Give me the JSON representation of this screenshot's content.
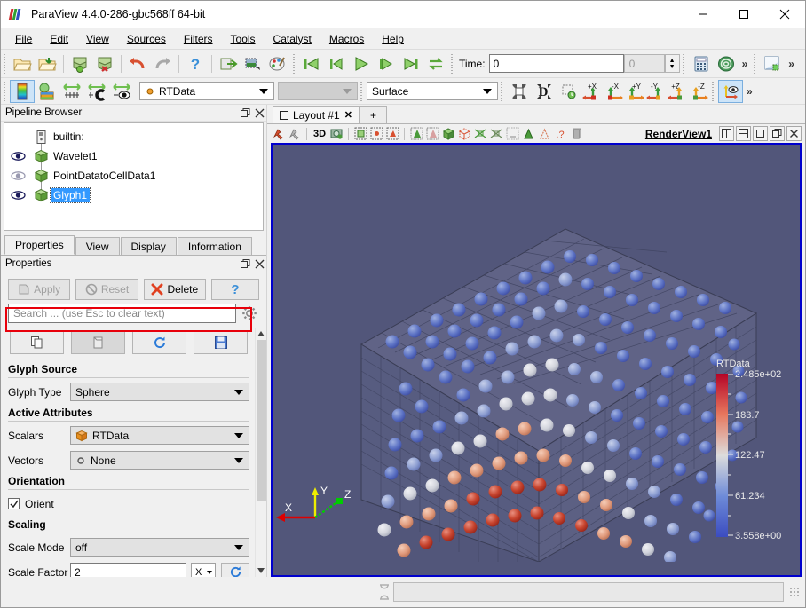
{
  "window": {
    "title": "ParaView 4.4.0-286-gbc568ff 64-bit",
    "minimize": "—",
    "maximize": "□",
    "close": "✕"
  },
  "menu": [
    {
      "label": "File",
      "mnemonic": "F"
    },
    {
      "label": "Edit",
      "mnemonic": "E"
    },
    {
      "label": "View",
      "mnemonic": "V"
    },
    {
      "label": "Sources",
      "mnemonic": "S"
    },
    {
      "label": "Filters",
      "mnemonic": "F"
    },
    {
      "label": "Tools",
      "mnemonic": "T"
    },
    {
      "label": "Catalyst",
      "mnemonic": "C"
    },
    {
      "label": "Macros",
      "mnemonic": "M"
    },
    {
      "label": "Help",
      "mnemonic": "H"
    }
  ],
  "main_toolbar": {
    "icons": [
      "open-file-icon",
      "open-recent-icon",
      "save-data-icon",
      "save-state-icon",
      "undo-icon",
      "redo-icon",
      "help-icon",
      "connect-server-icon",
      "disconnect-server-icon",
      "color-palette-icon"
    ],
    "vcr": [
      "first-frame-icon",
      "previous-frame-icon",
      "play-icon",
      "next-frame-icon",
      "last-frame-icon",
      "loop-icon"
    ],
    "time_label": "Time:",
    "time_value": "0",
    "frame_value": "0",
    "overflow": "»",
    "extra_icons": [
      "calculator-icon",
      "contour-icon",
      "screenshot-icon"
    ]
  },
  "repr_toolbar": {
    "icons": [
      "color-map-editor-icon",
      "edit-color-legend-icon",
      "rescale-data-range-icon",
      "rescale-custom-range-icon",
      "rescale-visible-range-icon"
    ],
    "array_value": "RTData",
    "component_value": "",
    "representation_value": "Surface",
    "camera_icons": [
      "reset-camera-icon",
      "zoom-to-data-icon",
      "zoom-to-box-icon",
      "plus-x-icon",
      "minus-x-icon",
      "plus-y-icon",
      "minus-y-icon",
      "plus-z-icon",
      "minus-z-icon"
    ],
    "axes_toggle": "center-axes-visibility-icon",
    "overflow": "»"
  },
  "pipeline_browser": {
    "title": "Pipeline Browser",
    "undock": "❐",
    "close": "✕",
    "items": [
      {
        "label": "builtin:",
        "icon": "server-icon",
        "eye": false,
        "selected": false,
        "indent": 0
      },
      {
        "label": "Wavelet1",
        "icon": "source-box-icon",
        "eye": true,
        "eye_state": "visible",
        "selected": false,
        "indent": 1
      },
      {
        "label": "PointDatatoCellData1",
        "icon": "filter-box-icon",
        "eye": true,
        "eye_state": "hidden",
        "selected": false,
        "indent": 1
      },
      {
        "label": "Glyph1",
        "icon": "filter-box-icon",
        "eye": true,
        "eye_state": "visible",
        "selected": true,
        "indent": 1
      }
    ]
  },
  "panel_tabs": [
    {
      "label": "Properties",
      "active": true
    },
    {
      "label": "View",
      "active": false
    },
    {
      "label": "Display",
      "active": false
    },
    {
      "label": "Information",
      "active": false
    }
  ],
  "properties": {
    "title": "Properties",
    "undock": "❐",
    "close": "✕",
    "apply_label": "Apply",
    "apply_mnemonic": "A",
    "reset_label": "Reset",
    "reset_mnemonic": "R",
    "delete_label": "Delete",
    "delete_mnemonic": "D",
    "help_label": "?",
    "search_placeholder": "Search ... (use Esc to clear text)",
    "gear_icon": "gear-icon",
    "toolbar_icons": [
      "copy-properties-icon",
      "paste-properties-icon",
      "restore-defaults-icon",
      "save-as-defaults-icon"
    ],
    "sections": {
      "glyph_source": {
        "title": "Glyph Source",
        "glyph_type_label": "Glyph Type",
        "glyph_type_value": "Sphere"
      },
      "active_attributes": {
        "title": "Active Attributes",
        "scalars_label": "Scalars",
        "scalars_value": "RTData",
        "scalars_icon": "point-data-array-icon",
        "vectors_label": "Vectors",
        "vectors_value": "None",
        "vectors_icon": "none-array-icon",
        "highlight_color": "#e8000b"
      },
      "orientation": {
        "title": "Orientation",
        "orient_label": "Orient",
        "orient_checked": true
      },
      "scaling": {
        "title": "Scaling",
        "scale_mode_label": "Scale Mode",
        "scale_mode_value": "off",
        "scale_factor_label": "Scale Factor",
        "scale_factor_value": "2",
        "scale_factor_unit": "X",
        "recompute_icon": "recompute-icon"
      }
    }
  },
  "layout": {
    "tab_label": "Layout #1",
    "tab_close": "✕",
    "new_tab": "+",
    "view_toolbar_icons": [
      "interactive-select-icon",
      "interactive-points-icon",
      "3D",
      "camera-icon",
      "select-cells-icon",
      "select-points-icon",
      "select-cells-through-icon",
      "select-points-polygon-icon",
      "select-cells-polygon-icon",
      "select-block-icon",
      "hover-cells-icon",
      "hover-points-icon",
      "clear-selection-icon",
      "find-data-icon",
      "plot-over-time-icon",
      "question-icon",
      "trash-icon"
    ],
    "view_3d_label": "3D",
    "view_name": "RenderView1",
    "window_buttons": [
      "split-horizontal-icon",
      "split-vertical-icon",
      "maximize-view-icon",
      "undock-view-icon",
      "close-view-icon"
    ]
  },
  "render_view": {
    "background_color": "#52567a",
    "border_color": "#0000cd",
    "scalar_bar": {
      "title": "RTData",
      "ticks": [
        "2.485e+02",
        "183.7",
        "122.47",
        "61.234",
        "3.558e+00"
      ],
      "min": 3.558,
      "max": 248.5,
      "colormap": "Cool to Warm",
      "color_low": "#3b4cc0",
      "color_mid": "#dddddd",
      "color_high": "#b40426"
    },
    "orientation_axes": {
      "x_label": "X",
      "x_color": "#dd0000",
      "y_label": "Y",
      "y_color": "#eeee00",
      "z_label": "Z",
      "z_color": "#00cc00"
    },
    "dataset": "Wavelet glyph sphere grid"
  },
  "status_bar": {
    "progress_icon": "progress-icon",
    "progress_value": ""
  }
}
